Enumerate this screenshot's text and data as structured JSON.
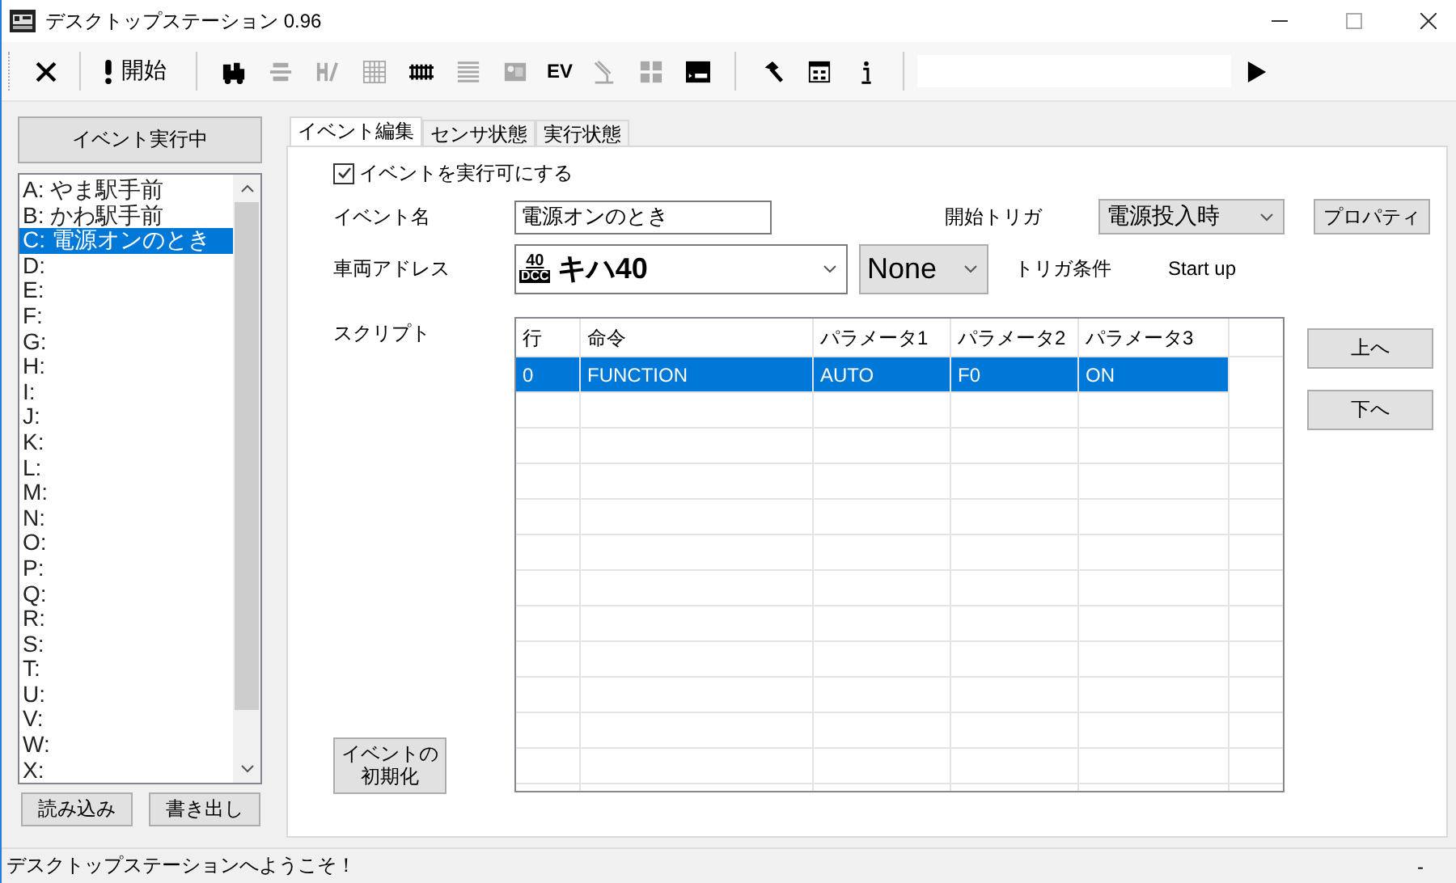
{
  "window": {
    "title": "デスクトップステーション 0.96"
  },
  "toolbar": {
    "items": [
      {
        "kind": "close",
        "disabled": false
      },
      {
        "kind": "start",
        "label": "開始",
        "disabled": false
      },
      {
        "kind": "loco",
        "disabled": false
      },
      {
        "kind": "signal",
        "disabled": true
      },
      {
        "kind": "points",
        "disabled": true
      },
      {
        "kind": "grid",
        "disabled": true
      },
      {
        "kind": "track",
        "disabled": false
      },
      {
        "kind": "list",
        "disabled": true
      },
      {
        "kind": "panel",
        "disabled": true
      },
      {
        "kind": "text",
        "label": "EV",
        "disabled": false
      },
      {
        "kind": "crane",
        "disabled": true
      },
      {
        "kind": "tiles",
        "disabled": true
      },
      {
        "kind": "com",
        "disabled": false
      },
      {
        "kind": "hammer",
        "disabled": false
      },
      {
        "kind": "window",
        "disabled": false
      },
      {
        "kind": "info",
        "disabled": false
      }
    ]
  },
  "left_panel": {
    "run_button": "イベント実行中",
    "events": [
      {
        "label": "A: やま駅手前",
        "selected": false
      },
      {
        "label": "B: かわ駅手前",
        "selected": false
      },
      {
        "label": "C: 電源オンのとき",
        "selected": true
      },
      {
        "label": "D:",
        "selected": false
      },
      {
        "label": "E:",
        "selected": false
      },
      {
        "label": "F:",
        "selected": false
      },
      {
        "label": "G:",
        "selected": false
      },
      {
        "label": "H:",
        "selected": false
      },
      {
        "label": "I:",
        "selected": false
      },
      {
        "label": "J:",
        "selected": false
      },
      {
        "label": "K:",
        "selected": false
      },
      {
        "label": "L:",
        "selected": false
      },
      {
        "label": "M:",
        "selected": false
      },
      {
        "label": "N:",
        "selected": false
      },
      {
        "label": "O:",
        "selected": false
      },
      {
        "label": "P:",
        "selected": false
      },
      {
        "label": "Q:",
        "selected": false
      },
      {
        "label": "R:",
        "selected": false
      },
      {
        "label": "S:",
        "selected": false
      },
      {
        "label": "T:",
        "selected": false
      },
      {
        "label": "U:",
        "selected": false
      },
      {
        "label": "V:",
        "selected": false
      },
      {
        "label": "W:",
        "selected": false
      },
      {
        "label": "X:",
        "selected": false
      }
    ],
    "buttons": [
      "読み込み",
      "書き出し"
    ]
  },
  "tabs": [
    {
      "label": "イベント編集",
      "selected": true
    },
    {
      "label": "センサ状態",
      "selected": false
    },
    {
      "label": "実行状態",
      "selected": false
    }
  ],
  "event_editor": {
    "enable_checkbox": {
      "label": "イベントを実行可にする",
      "checked": true
    },
    "event_name": {
      "label": "イベント名",
      "value": "電源オンのとき"
    },
    "start_trigger": {
      "label": "開始トリガ",
      "value": "電源投入時"
    },
    "properties_button": "プロパティ",
    "vehicle_address": {
      "label": "車両アドレス",
      "badge_number": "40",
      "badge_text": "DCC",
      "value": "キハ40"
    },
    "condition_dropdown": {
      "value": "None"
    },
    "trigger_condition": {
      "label": "トリガ条件",
      "value": "Start up"
    },
    "script_label": "スクリプト",
    "script_table": {
      "columns": [
        "行",
        "命令",
        "パラメータ1",
        "パラメータ2",
        "パラメータ3"
      ],
      "rows": [
        {
          "cells": [
            "0",
            "FUNCTION",
            "AUTO",
            "F0",
            "ON"
          ],
          "selected": true
        }
      ]
    },
    "up_button": "上へ",
    "down_button": "下へ",
    "reset_button": "イベントの初期化"
  },
  "status_bar": {
    "message": "デスクトップステーションへようこそ！",
    "right": "-"
  }
}
